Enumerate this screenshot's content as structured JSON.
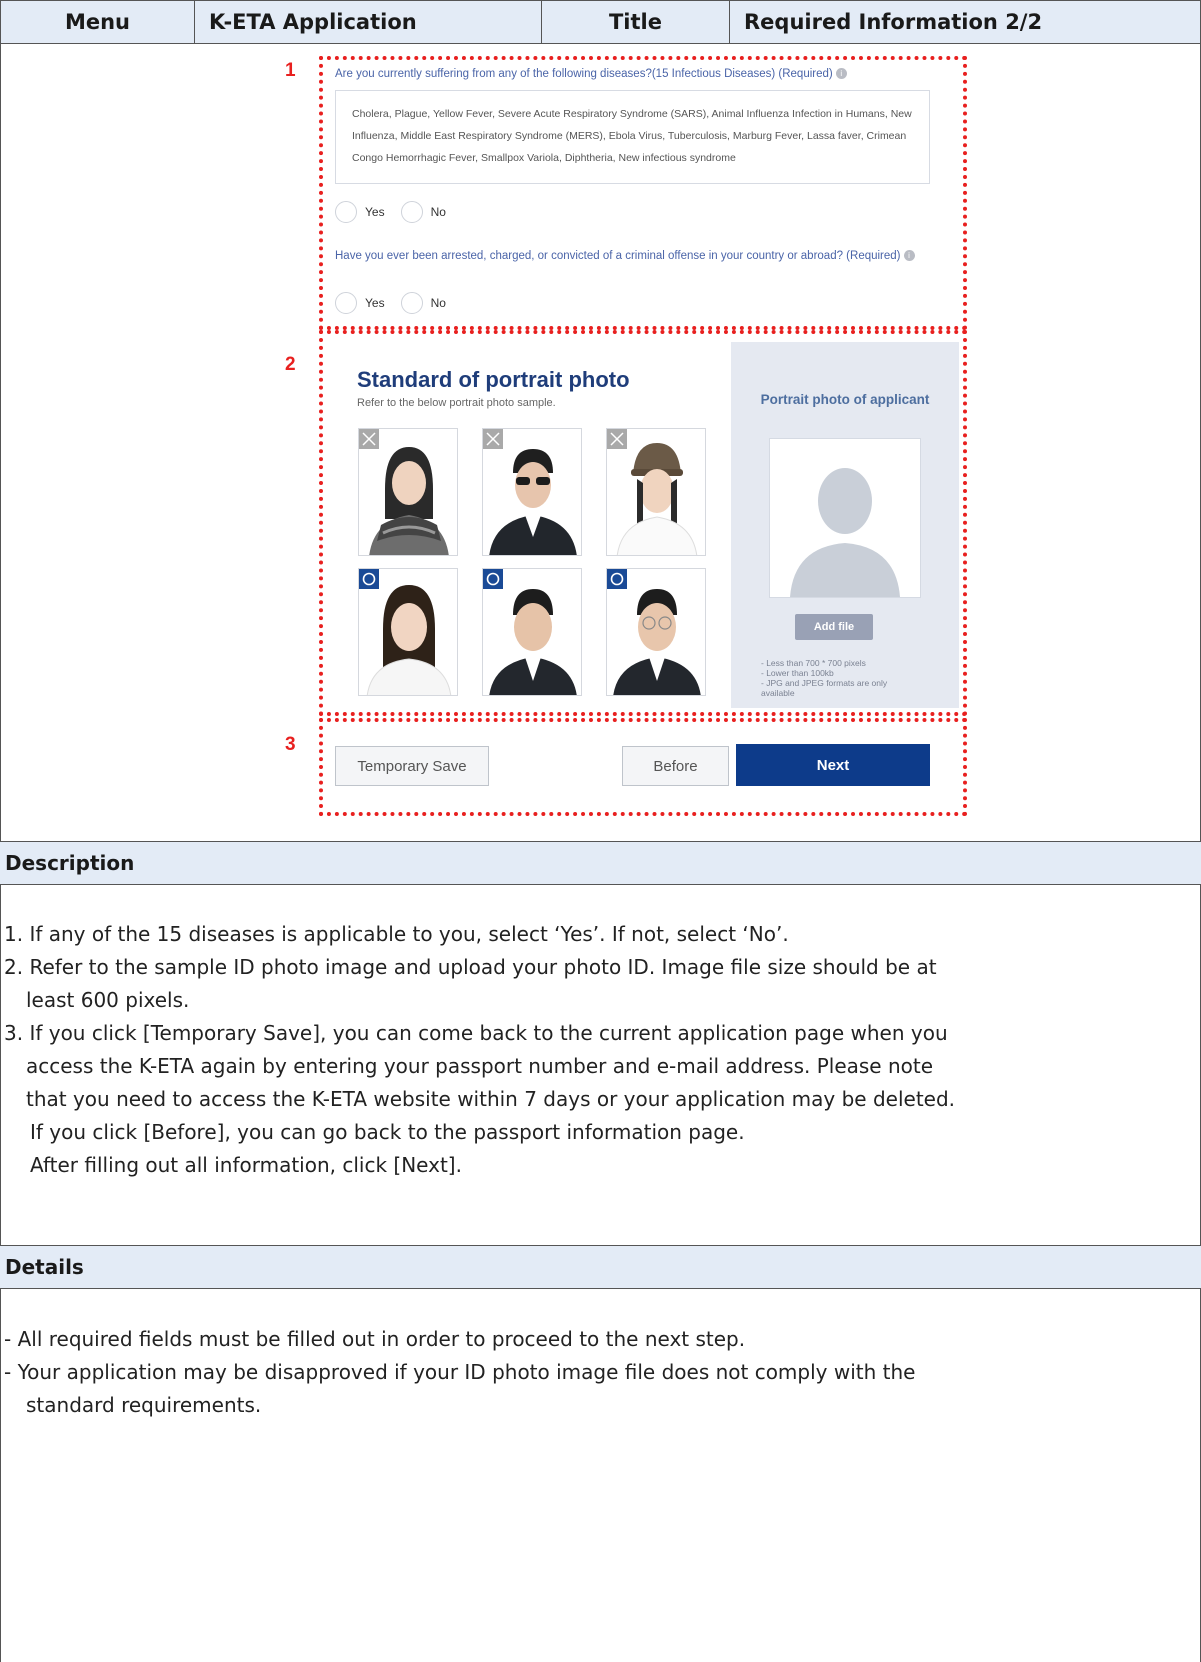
{
  "header": {
    "menu_label": "Menu",
    "menu_value": "K-ETA Application",
    "title_label": "Title",
    "title_value": "Required Information 2/2"
  },
  "screenshot": {
    "markers": [
      "1",
      "2",
      "3"
    ],
    "q1": {
      "text": "Are you currently suffering from any of the following diseases?(15 Infectious Diseases) (Required)",
      "diseases": "Cholera, Plague, Yellow Fever, Severe Acute Respiratory Syndrome (SARS), Animal Influenza Infection in Humans, New Influenza, Middle East Respiratory Syndrome (MERS), Ebola Virus, Tuberculosis, Marburg Fever, Lassa faver, Crimean Congo Hemorrhagic Fever, Smallpox Variola, Diphtheria, New infectious syndrome",
      "yes": "Yes",
      "no": "No"
    },
    "q2": {
      "text": "Have you ever been arrested, charged, or convicted of a criminal offense in your country or abroad? (Required)",
      "yes": "Yes",
      "no": "No"
    },
    "photo_standard": {
      "title": "Standard of portrait photo",
      "subtitle": "Refer to the below portrait photo sample.",
      "panel_title": "Portrait photo of applicant",
      "add_file": "Add file",
      "requirements": [
        "- Less than 700 * 700 pixels",
        "- Lower than 100kb",
        "- JPG and JPEG formats are only available"
      ]
    },
    "buttons": {
      "temporary_save": "Temporary Save",
      "before": "Before",
      "next": "Next"
    }
  },
  "description": {
    "heading": "Description",
    "items": [
      "1. If any of the 15 diseases is applicable to you, select ‘Yes’. If not, select ‘No’.",
      "2. Refer to the sample ID photo image and upload your photo ID. Image file size should be at",
      "least 600 pixels.",
      "3. If you click [Temporary Save], you can come back to the current application page when you",
      "access the K-ETA again by entering your passport number and e-mail address. Please note",
      "that you need to access the K-ETA website within 7 days or your application may be deleted.",
      "If you click [Before], you can go back to the passport information page.",
      "After filling out all information, click [Next]."
    ]
  },
  "details": {
    "heading": "Details",
    "items": [
      "- All required fields must be filled out in order to proceed to the next step.",
      "- Your application may be disapproved if your ID photo image file does not comply with the",
      "standard requirements."
    ]
  }
}
